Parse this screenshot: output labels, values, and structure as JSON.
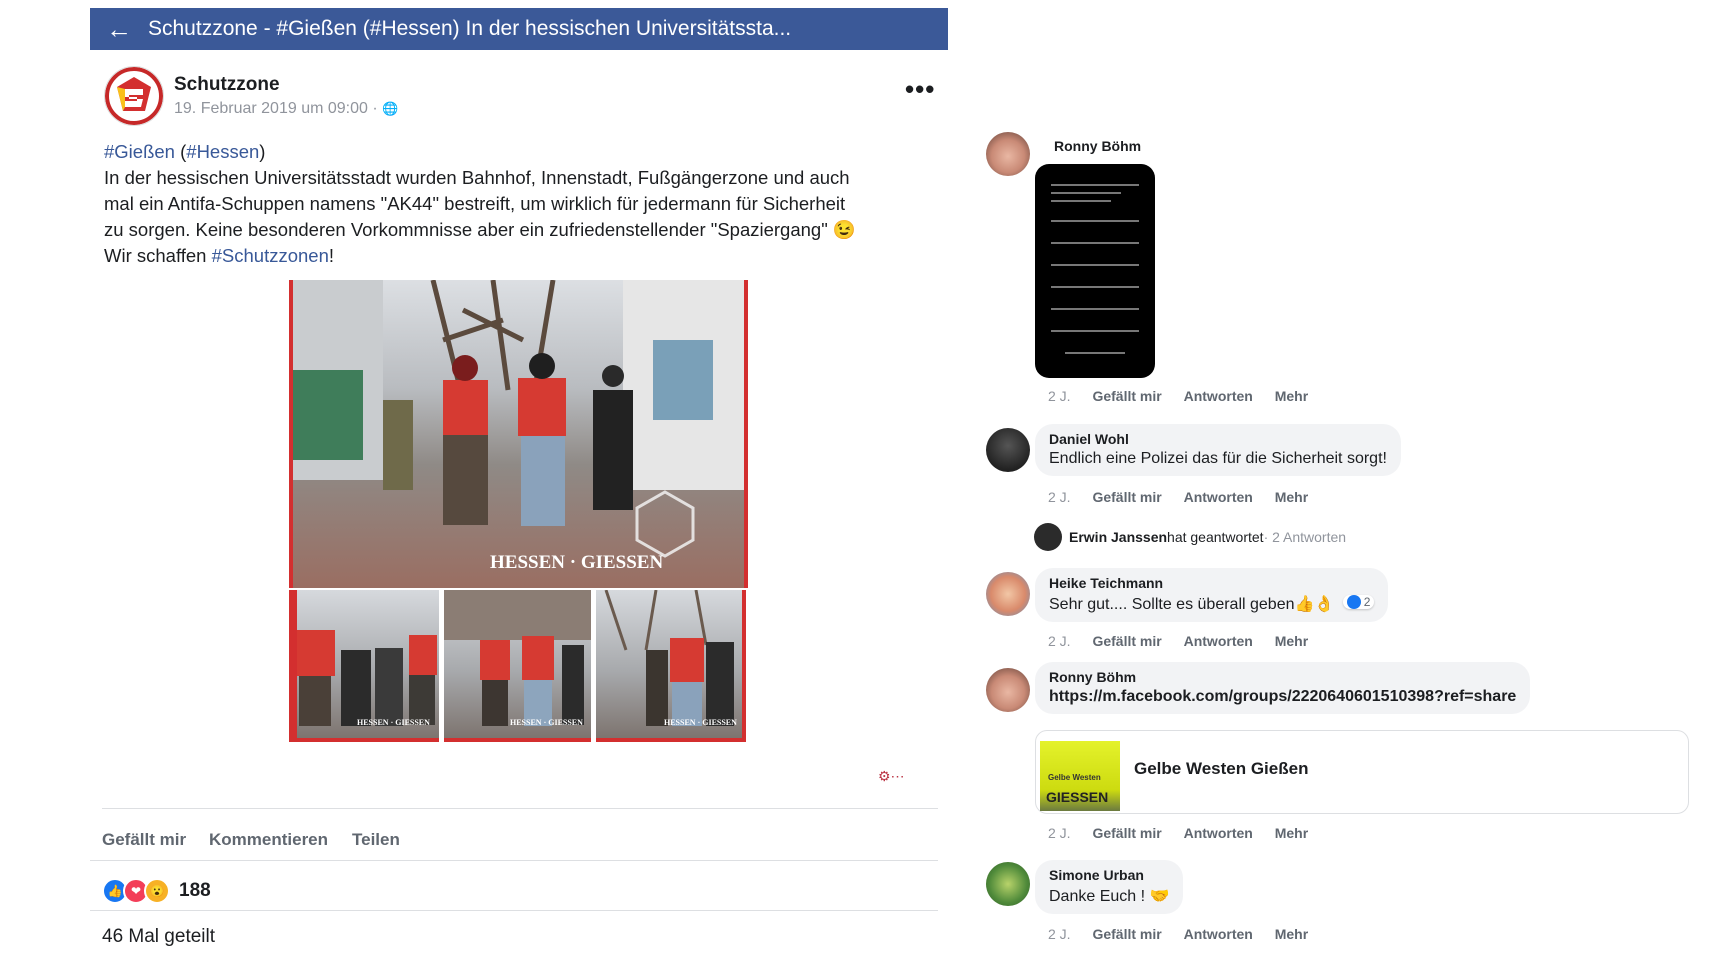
{
  "post": {
    "header_title": "Schutzzone - #Gießen (#Hessen) In der hessischen Universitätssta...",
    "author": "Schutzzone",
    "date": "19. Februar 2019 um 09:00 ·",
    "globe_icon": "🌐",
    "more": "•••",
    "tag1": "#Gießen",
    "tag2": "#Hessen",
    "text_line1": "In der hessischen Universitätsstadt wurden Bahnhof, Innenstadt, Fußgängerzone und auch",
    "text_line2": "mal ein Antifa-Schuppen namens \"AK44\" bestreift, um wirklich für jedermann für Sicherheit",
    "text_line3": "zu sorgen. Keine besonderen Vorkommnisse aber ein zufriedenstellender \"Spaziergang\" 😉",
    "text_line4a": "Wir schaffen ",
    "tag3": "#Schutzzonen",
    "text_line4b": "!",
    "image_caption": "HESSEN · GIESSEN",
    "thumb_caption": "HESSEN · GIESSEN",
    "actions": [
      "Gefällt mir",
      "Kommentieren",
      "Teilen"
    ],
    "reaction_count": "188",
    "shares": "46 Mal geteilt"
  },
  "comments": {
    "c1": {
      "name": "Ronny Böhm",
      "age": "2 J."
    },
    "c2": {
      "name": "Daniel Wohl",
      "text": "Endlich eine Polizei das für die Sicherheit sorgt!",
      "age": "2 J."
    },
    "reply": {
      "name": "Erwin Janssen",
      "text": " hat geantwortet",
      "count": " · 2 Antworten"
    },
    "c3": {
      "name": "Heike Teichmann",
      "text": "Sehr gut.... Sollte es überall geben👍👌",
      "likes": "2",
      "age": "2 J."
    },
    "c4": {
      "name": "Ronny Böhm",
      "text": "https://m.facebook.com/groups/2220640601510398?ref=share",
      "card_title": "Gelbe Westen Gießen",
      "card_img_text1": "Gelbe Westen",
      "card_img_text2": "GIESSEN",
      "age": "2 J."
    },
    "c5": {
      "name": "Simone Urban",
      "text": "Danke Euch ! 🤝",
      "age": "2 J."
    },
    "meta_labels": {
      "like": "Gefällt mir",
      "reply": "Antworten",
      "more": "Mehr"
    }
  },
  "colors": {
    "fb_blue": "#3b5998",
    "link": "#385898",
    "red_frame": "#d32f2f"
  }
}
